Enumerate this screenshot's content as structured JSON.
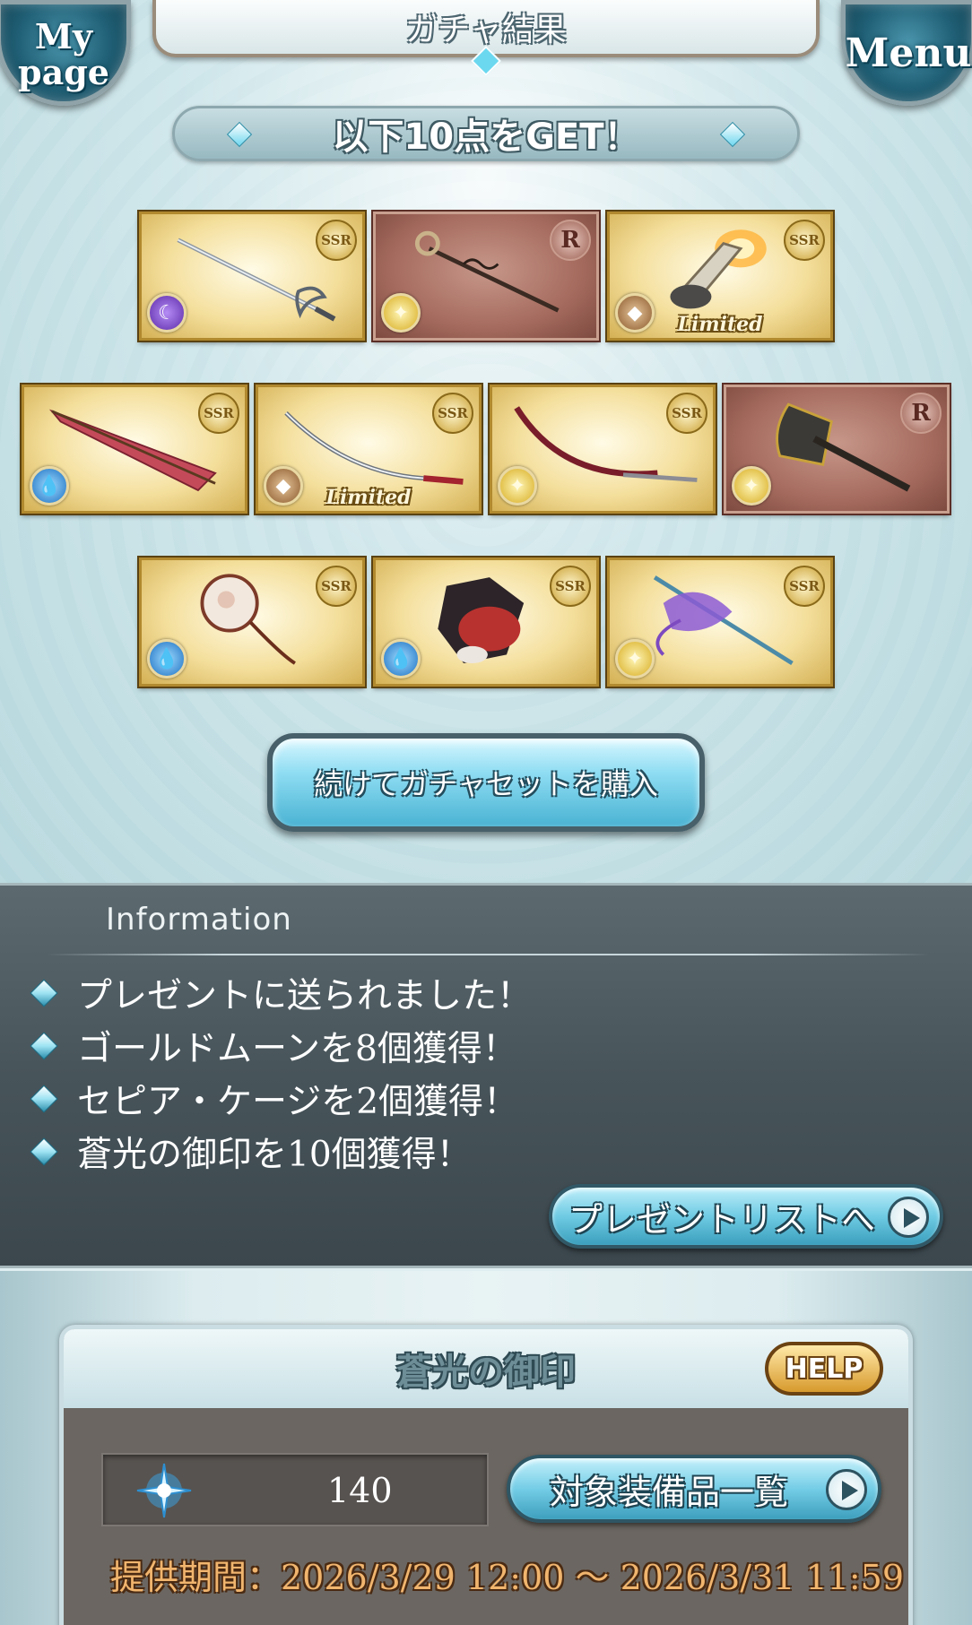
{
  "header": {
    "mypage_label_line1": "My",
    "mypage_label_line2": "page",
    "title": "ガチャ結果",
    "menu_label": "Menu"
  },
  "get_banner": "以下10点をGET！",
  "items": [
    {
      "rarity": "SSR",
      "element": "dark",
      "limited": false,
      "weapon": "sword"
    },
    {
      "rarity": "R",
      "element": "light",
      "limited": false,
      "weapon": "staff"
    },
    {
      "rarity": "SSR",
      "element": "earth",
      "limited": true,
      "weapon": "gauntlet"
    },
    {
      "rarity": "SSR",
      "element": "water",
      "limited": false,
      "weapon": "umbrella"
    },
    {
      "rarity": "SSR",
      "element": "earth",
      "limited": true,
      "weapon": "katana"
    },
    {
      "rarity": "SSR",
      "element": "light",
      "limited": false,
      "weapon": "scythe-blade"
    },
    {
      "rarity": "R",
      "element": "light",
      "limited": false,
      "weapon": "axe"
    },
    {
      "rarity": "SSR",
      "element": "water",
      "limited": false,
      "weapon": "fan"
    },
    {
      "rarity": "SSR",
      "element": "water",
      "limited": false,
      "weapon": "summon"
    },
    {
      "rarity": "SSR",
      "element": "light",
      "limited": false,
      "weapon": "spear"
    }
  ],
  "limited_label": "Limited",
  "continue_button": "続けてガチャセットを購入",
  "info": {
    "title": "Information",
    "lines": [
      "プレゼントに送られました！",
      "ゴールドムーンを8個獲得！",
      "セピア・ケージを2個獲得！",
      "蒼光の御印を10個獲得！"
    ],
    "present_button": "プレゼントリストへ"
  },
  "seal": {
    "title": "蒼光の御印",
    "help": "HELP",
    "count": "140",
    "equip_button": "対象装備品一覧",
    "period": "提供期間：2026/3/29 12:00 〜 2026/3/31 11:59"
  },
  "colors": {
    "ssr_gold": "#f4df9c",
    "r_bronze": "#a56b5e",
    "info_panel": "#47545a",
    "button_blue": "#6fcbe3",
    "period_orange": "#f1b56e"
  }
}
